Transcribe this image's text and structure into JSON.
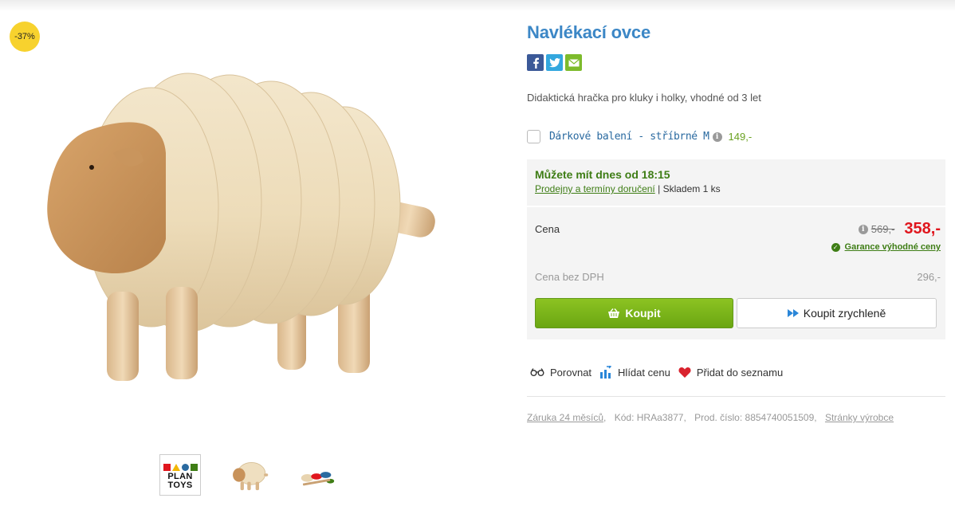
{
  "discount_badge": "-37%",
  "product": {
    "title": "Navlékací ovce",
    "description": "Didaktická hračka pro kluky i holky, vhodné od 3 let"
  },
  "gift_wrap": {
    "label": "Dárkové balení - stříbrné M",
    "price": "149,-"
  },
  "availability": {
    "headline": "Můžete mít dnes od 18:15",
    "link": "Prodejny a termíny doručení",
    "separator": "|",
    "stock": "Skladem 1 ks"
  },
  "pricing": {
    "label": "Cena",
    "old_price": "569,-",
    "new_price": "358,-",
    "guarantee": "Garance výhodné ceny",
    "net_label": "Cena bez DPH",
    "net_value": "296,-"
  },
  "buttons": {
    "buy": "Koupit",
    "quick_buy": "Koupit zrychleně"
  },
  "actions": {
    "compare": "Porovnat",
    "watch_price": "Hlídat cenu",
    "add_to_list": "Přidat do seznamu"
  },
  "meta": {
    "warranty": "Záruka 24 měsíců",
    "code": "Kód: HRAa3877",
    "product_number": "Prod. číslo: 8854740051509",
    "manufacturer_page": "Stránky výrobce"
  },
  "brand_logo": {
    "line1": "PLAN",
    "line2": "TOYS"
  },
  "icons": [
    "facebook-icon",
    "twitter-icon",
    "email-icon",
    "info-icon",
    "check-icon",
    "basket-icon",
    "fast-forward-icon",
    "glasses-icon",
    "chart-icon",
    "heart-icon"
  ],
  "colors": {
    "title": "#3c87c6",
    "price_red": "#e0161d",
    "green": "#3e7d15",
    "buy_button": "#7ab51d",
    "badge": "#f7d22e"
  }
}
